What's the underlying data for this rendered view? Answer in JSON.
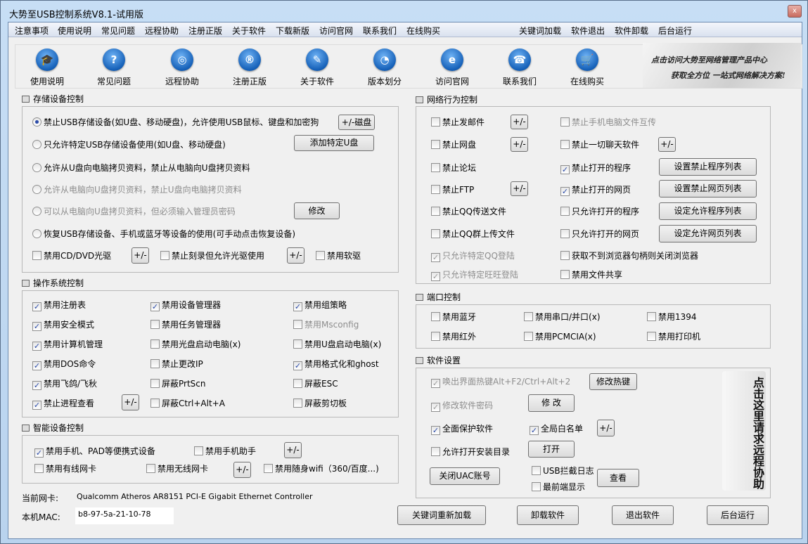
{
  "window": {
    "title": "大势至USB控制系统V8.1-试用版",
    "close": "x"
  },
  "menu": {
    "left": [
      "注意事项",
      "使用说明",
      "常见问题",
      "远程协助",
      "注册正版",
      "关于软件",
      "下载新版",
      "访问官网",
      "联系我们",
      "在线购买"
    ],
    "right": [
      "关键词加载",
      "软件退出",
      "软件卸载",
      "后台运行"
    ]
  },
  "toolbar": [
    {
      "label": "使用说明",
      "icon": "graduation-cap-icon",
      "g": "🎓"
    },
    {
      "label": "常见问题",
      "icon": "question-icon",
      "g": "?"
    },
    {
      "label": "远程协助",
      "icon": "globe-hand-icon",
      "g": "◎"
    },
    {
      "label": "注册正版",
      "icon": "registered-icon",
      "g": "®"
    },
    {
      "label": "关于软件",
      "icon": "document-edit-icon",
      "g": "✎"
    },
    {
      "label": "版本划分",
      "icon": "pie-chart-icon",
      "g": "◔"
    },
    {
      "label": "访问官网",
      "icon": "ie-icon",
      "g": "e"
    },
    {
      "label": "联系我们",
      "icon": "telephone-icon",
      "g": "☎"
    },
    {
      "label": "在线购买",
      "icon": "cart-icon",
      "g": "🛒"
    }
  ],
  "banner": {
    "line1": "点击访问大势至网络管理产品中心",
    "line2": "获取全方位 一站式网络解决方案!"
  },
  "storage": {
    "title": "存储设备控制",
    "radios": [
      {
        "label": "禁止USB存储设备(如U盘、移动硬盘)，允许使用USB鼠标、键盘和加密狗",
        "checked": true,
        "disabled": false
      },
      {
        "label": "只允许特定USB存储设备使用(如U盘、移动硬盘)",
        "checked": false,
        "disabled": false
      },
      {
        "label": "允许从U盘向电脑拷贝资料，禁止从电脑向U盘拷贝资料",
        "checked": false,
        "disabled": false
      },
      {
        "label": "允许从电脑向U盘拷贝资料，禁止U盘向电脑拷贝资料",
        "checked": false,
        "disabled": true
      },
      {
        "label": "可以从电脑向U盘拷贝资料，但必须输入管理员密码",
        "checked": false,
        "disabled": true
      },
      {
        "label": "恢复USB存储设备、手机或蓝牙等设备的使用(可手动点击恢复设备)",
        "checked": false,
        "disabled": false
      }
    ],
    "checks": [
      {
        "label": "禁用CD/DVD光驱",
        "checked": false
      },
      {
        "label": "禁止刻录但允许光驱使用",
        "checked": false
      },
      {
        "label": "禁用软驱",
        "checked": false
      }
    ],
    "buttons": {
      "disk": "+/-磁盘",
      "add_u": "添加特定U盘",
      "modify": "修改",
      "pm": "+/-"
    }
  },
  "os": {
    "title": "操作系统控制",
    "checks": [
      {
        "label": "禁用注册表",
        "checked": true
      },
      {
        "label": "禁用设备管理器",
        "checked": true
      },
      {
        "label": "禁用组策略",
        "checked": true
      },
      {
        "label": "禁用安全模式",
        "checked": true
      },
      {
        "label": "禁用任务管理器",
        "checked": false
      },
      {
        "label": "禁用Msconfig",
        "checked": false,
        "disabled": true
      },
      {
        "label": "禁用计算机管理",
        "checked": true
      },
      {
        "label": "禁用光盘启动电脑(x)",
        "checked": false
      },
      {
        "label": "禁用U盘启动电脑(x)",
        "checked": false
      },
      {
        "label": "禁用DOS命令",
        "checked": true
      },
      {
        "label": "禁止更改IP",
        "checked": false
      },
      {
        "label": "禁用格式化和ghost",
        "checked": true
      },
      {
        "label": "禁用飞鸽/飞秋",
        "checked": true
      },
      {
        "label": "屏蔽PrtScn",
        "checked": false
      },
      {
        "label": "屏蔽ESC",
        "checked": false
      },
      {
        "label": "禁止进程查看",
        "checked": true
      },
      {
        "label": "屏蔽Ctrl+Alt+A",
        "checked": false
      },
      {
        "label": "屏蔽剪切板",
        "checked": false
      }
    ],
    "pm": "+/-"
  },
  "smart": {
    "title": "智能设备控制",
    "checks": [
      {
        "label": "禁用手机、PAD等便携式设备",
        "checked": true
      },
      {
        "label": "禁用手机助手",
        "checked": false
      },
      {
        "label": "禁用有线网卡",
        "checked": false
      },
      {
        "label": "禁用无线网卡",
        "checked": false
      },
      {
        "label": "禁用随身wifi（360/百度...)",
        "checked": false
      }
    ],
    "pm": "+/-"
  },
  "nic": {
    "label": "当前网卡:",
    "value": "Qualcomm Atheros AR8151 PCI-E Gigabit Ethernet Controller",
    "mac_label": "本机MAC:",
    "mac": "b8-97-5a-21-10-78"
  },
  "network": {
    "title": "网络行为控制",
    "left": [
      {
        "label": "禁止发邮件",
        "checked": false
      },
      {
        "label": "禁止网盘",
        "checked": false
      },
      {
        "label": "禁止论坛",
        "checked": false
      },
      {
        "label": "禁止FTP",
        "checked": false
      },
      {
        "label": "禁止QQ传送文件",
        "checked": false
      },
      {
        "label": "禁止QQ群上传文件",
        "checked": false
      },
      {
        "label": "只允许特定QQ登陆",
        "checked": true,
        "disabled": true
      },
      {
        "label": "只允许特定旺旺登陆",
        "checked": true,
        "disabled": true
      }
    ],
    "right": [
      {
        "label": "禁止手机电脑文件互传",
        "checked": false,
        "disabled": true
      },
      {
        "label": "禁止一切聊天软件",
        "checked": false
      },
      {
        "label": "禁止打开的程序",
        "checked": true
      },
      {
        "label": "禁止打开的网页",
        "checked": true
      },
      {
        "label": "只允许打开的程序",
        "checked": false
      },
      {
        "label": "只允许打开的网页",
        "checked": false
      },
      {
        "label": "获取不到浏览器句柄则关闭浏览器",
        "checked": false
      },
      {
        "label": "禁用文件共享",
        "checked": false
      }
    ],
    "buttons": [
      "设置禁止程序列表",
      "设置禁止网页列表",
      "设定允许程序列表",
      "设定允许网页列表"
    ],
    "pm": "+/-"
  },
  "port": {
    "title": "端口控制",
    "checks": [
      {
        "label": "禁用蓝牙",
        "checked": false
      },
      {
        "label": "禁用串口/并口(x)",
        "checked": false
      },
      {
        "label": "禁用1394",
        "checked": false
      },
      {
        "label": "禁用红外",
        "checked": false
      },
      {
        "label": "禁用PCMCIA(x)",
        "checked": false
      },
      {
        "label": "禁用打印机",
        "checked": false
      }
    ]
  },
  "software": {
    "title": "软件设置",
    "checks": [
      {
        "label": "唤出界面热键Alt+F2/Ctrl+Alt+2",
        "checked": true,
        "disabled": true
      },
      {
        "label": "修改软件密码",
        "checked": true,
        "disabled": true
      },
      {
        "label": "全面保护软件",
        "checked": true
      },
      {
        "label": "全局白名单",
        "checked": true
      },
      {
        "label": "允许打开安装目录",
        "checked": false
      },
      {
        "label": "USB拦截日志",
        "checked": false
      },
      {
        "label": "最前端显示",
        "checked": false
      }
    ],
    "buttons": {
      "hotkey": "修改热键",
      "modify": "修 改",
      "pm": "+/-",
      "open": "打开",
      "uac": "关闭UAC账号",
      "view": "查看"
    },
    "side_image": "点击这里请求远程协助"
  },
  "bottom": [
    "关键词重新加载",
    "卸载软件",
    "退出软件",
    "后台运行"
  ]
}
